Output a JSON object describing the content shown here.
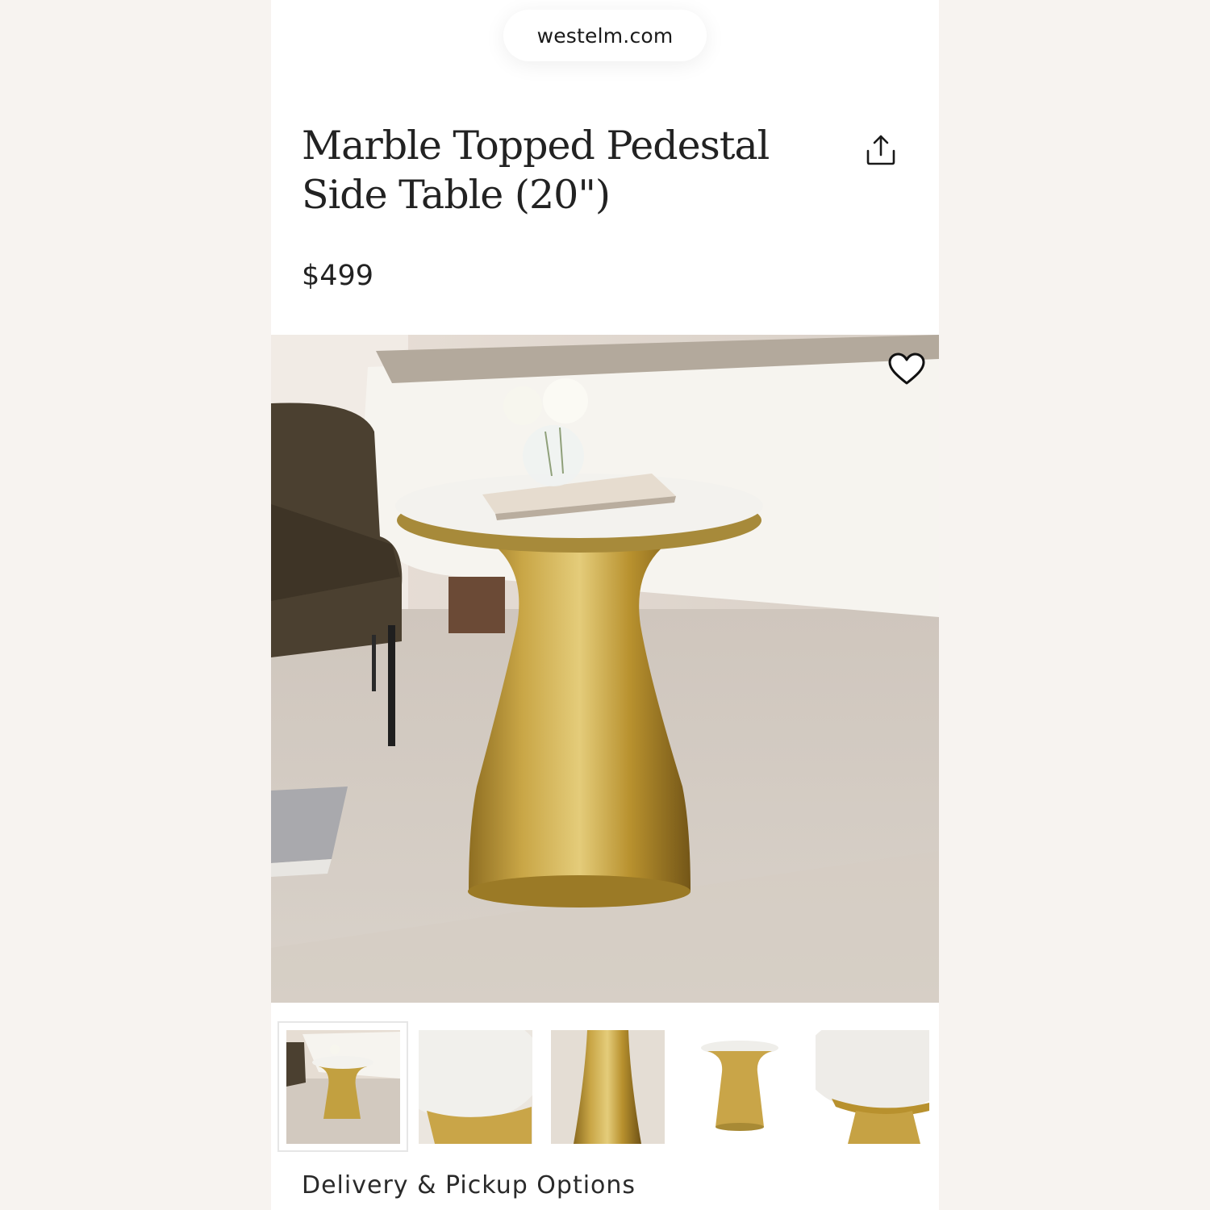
{
  "browser": {
    "url_text": "westelm.com"
  },
  "product": {
    "title": "Marble Topped Pedestal Side Table (20\")",
    "price": "$499"
  },
  "icons": {
    "share": "share-icon",
    "favorite": "heart-icon"
  },
  "gallery": {
    "thumbnails": [
      {
        "label": "room view",
        "selected": true
      },
      {
        "label": "marble top detail",
        "selected": false
      },
      {
        "label": "brass base detail",
        "selected": false
      },
      {
        "label": "full product",
        "selected": false
      },
      {
        "label": "top edge detail",
        "selected": false
      }
    ]
  },
  "sections": {
    "delivery_title": "Delivery & Pickup Options"
  },
  "colors": {
    "brass": "#b8912e",
    "marble": "#f3f2ee",
    "page_bg": "#f7f3f0"
  }
}
